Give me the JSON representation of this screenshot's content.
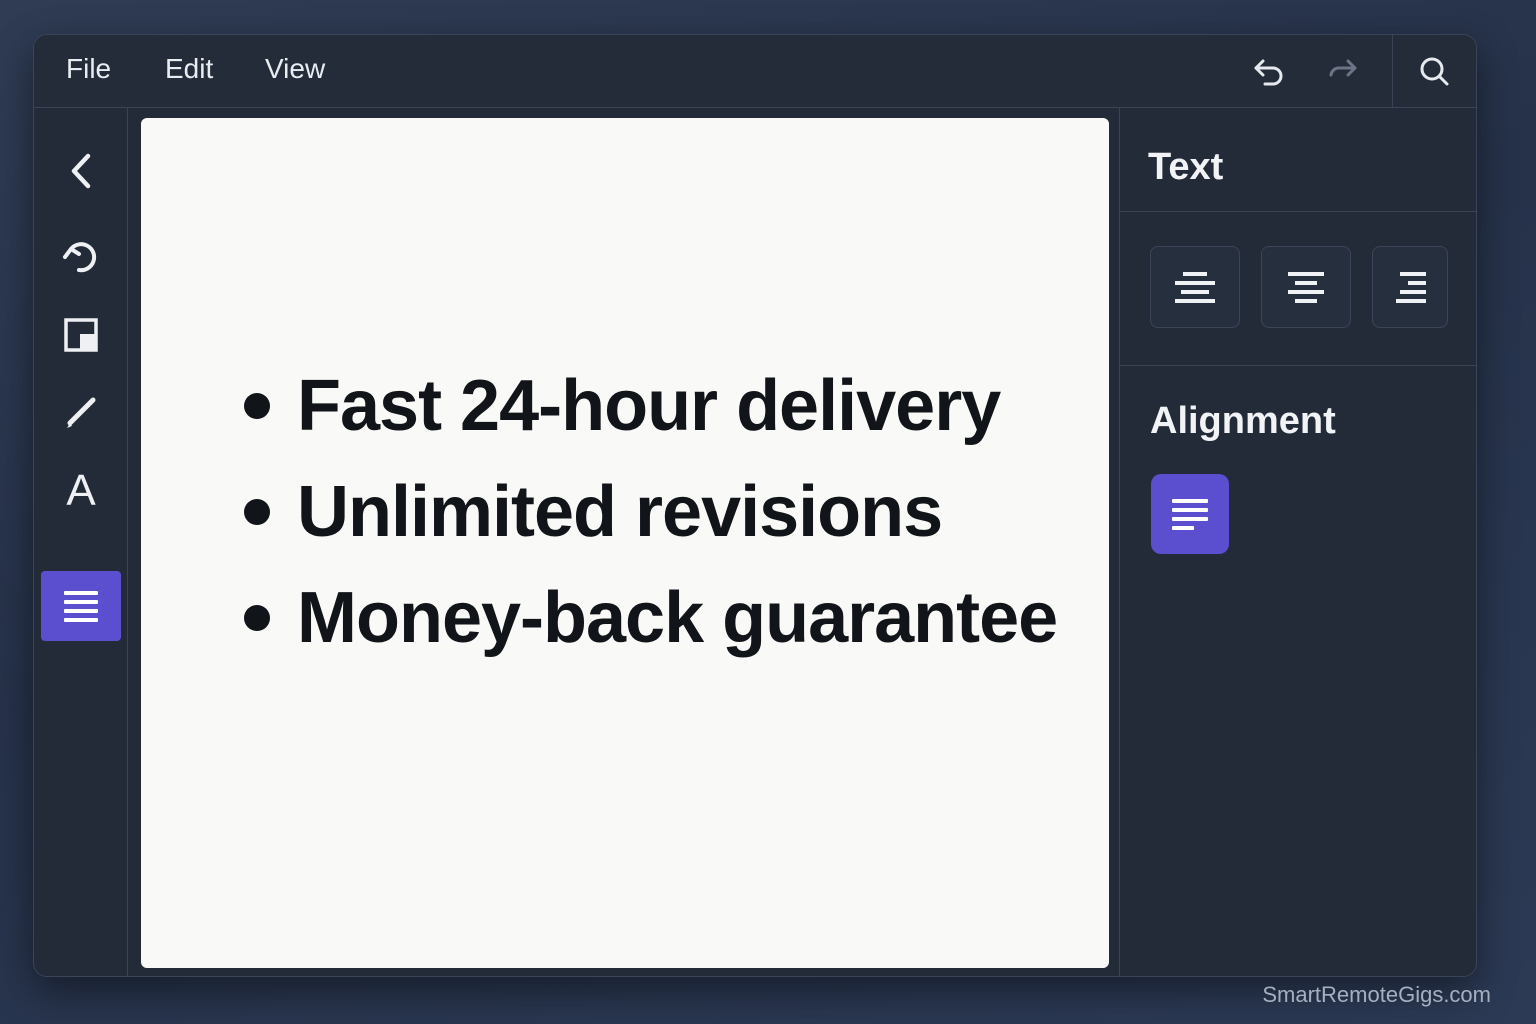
{
  "menu": {
    "items": [
      {
        "label": "File"
      },
      {
        "label": "Edit"
      },
      {
        "label": "View"
      }
    ]
  },
  "toolbar": {
    "icons": [
      "undo-icon",
      "redo-icon",
      "search-icon"
    ]
  },
  "sidebar": {
    "tools": [
      "back-icon",
      "rotate-icon",
      "frame-icon",
      "pen-icon",
      "text-icon",
      "align-icon"
    ],
    "active_tool": "align-icon",
    "text_tool_glyph": "A"
  },
  "canvas": {
    "bullets": [
      {
        "text": "Fast 24-hour delivery"
      },
      {
        "text": "Unlimited revisions"
      },
      {
        "text": "Money-back guarantee"
      }
    ]
  },
  "panel": {
    "title": "Text",
    "section_title": "Alignment"
  },
  "colors": {
    "accent": "#5b4fd0",
    "window_bg": "#232b38",
    "canvas_bg": "#f9f9f7"
  },
  "watermark": "SmartRemoteGigs.com"
}
